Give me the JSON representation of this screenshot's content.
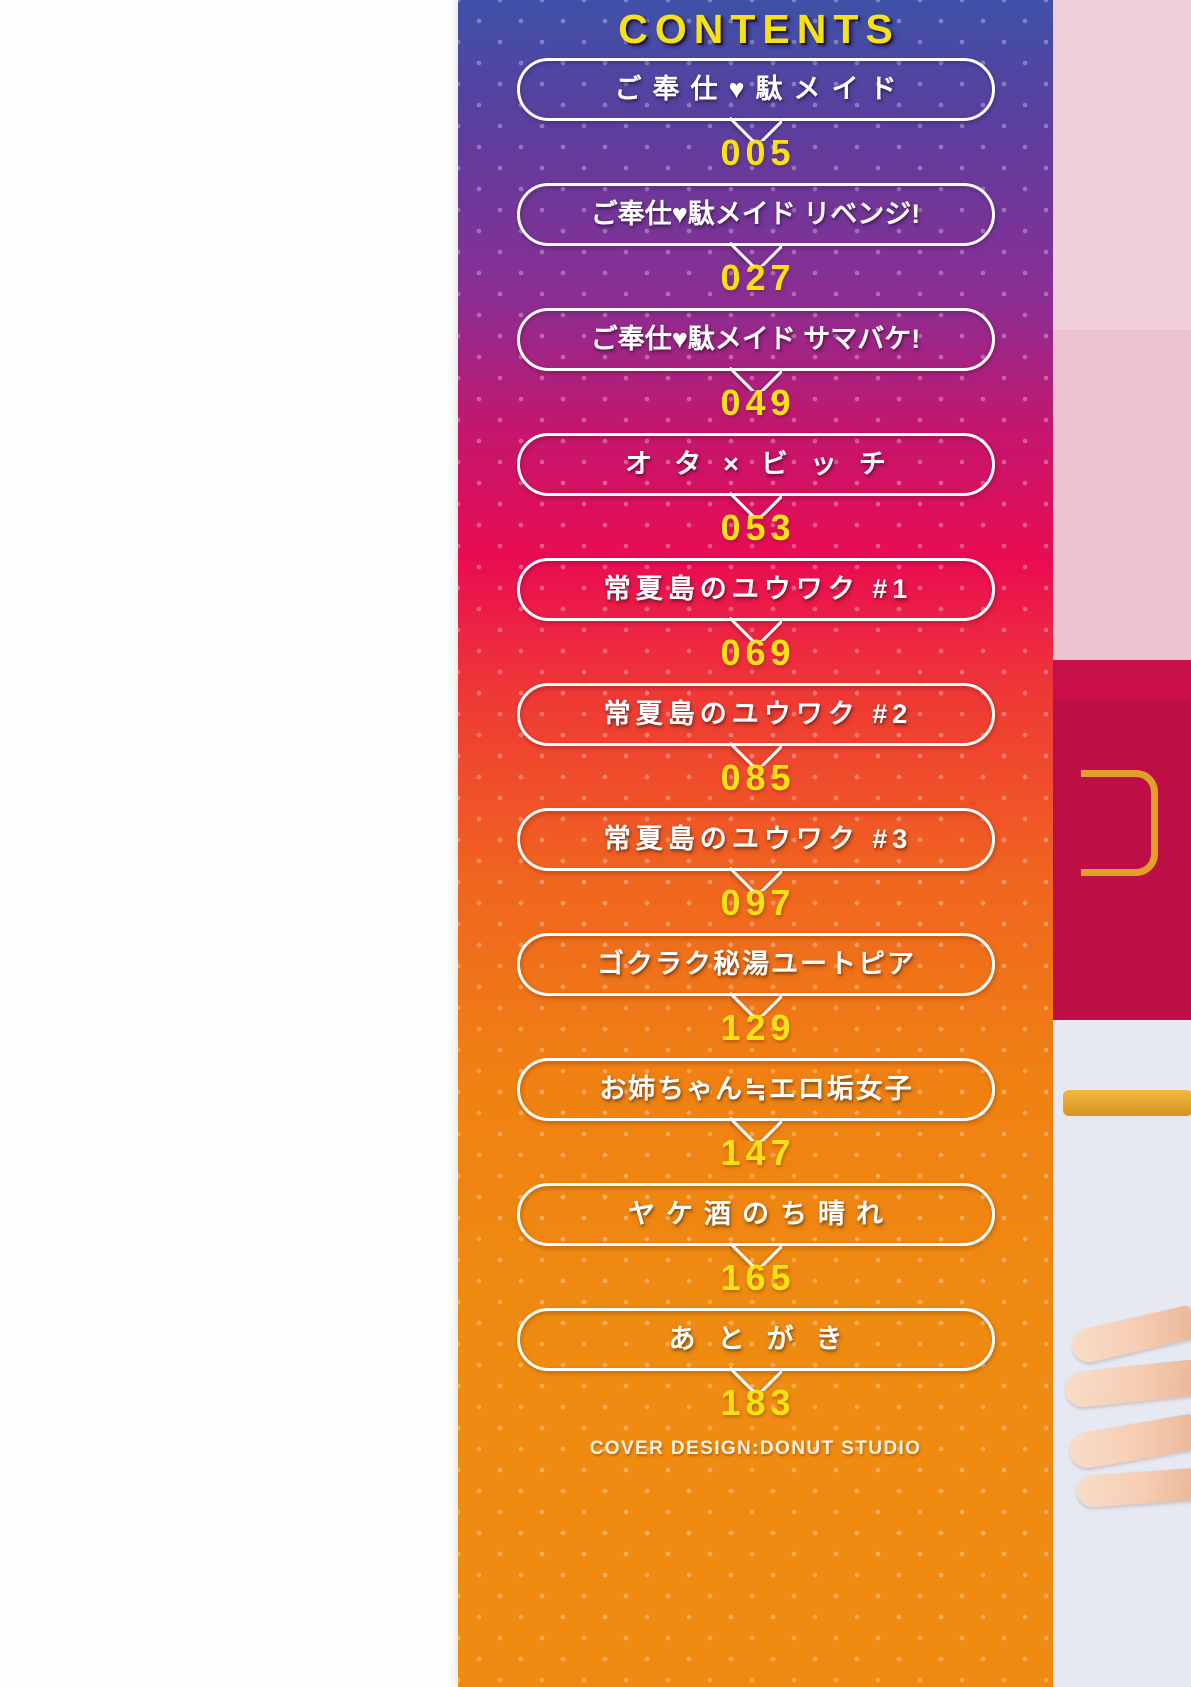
{
  "panel": {
    "title": "CONTENTS",
    "credit": "COVER DESIGN:DONUT STUDIO",
    "colors": {
      "accent_yellow": "#f5e215",
      "outline_white": "#ffffff",
      "gradient_top": "#3f51a8",
      "gradient_mid": "#ea0c52",
      "gradient_bottom": "#ef8b11"
    }
  },
  "entries": [
    {
      "title": "ご奉仕♥駄メイド",
      "page": "005",
      "style": "tracked"
    },
    {
      "title": "ご奉仕♥駄メイド リベンジ!",
      "page": "027",
      "style": "compact"
    },
    {
      "title": "ご奉仕♥駄メイド サマバケ!",
      "page": "049",
      "style": "compact"
    },
    {
      "title": "オタ×ビッチ",
      "page": "053",
      "style": "tracked-xl"
    },
    {
      "title": "常夏島のユウワク #1",
      "page": "069",
      "style": "tracked-s"
    },
    {
      "title": "常夏島のユウワク #2",
      "page": "085",
      "style": "tracked-s"
    },
    {
      "title": "常夏島のユウワク #3",
      "page": "097",
      "style": "tracked-s"
    },
    {
      "title": "ゴクラク秘湯ユートピア",
      "page": "129",
      "style": "tracked-xs"
    },
    {
      "title": "お姉ちゃん≒エロ垢女子",
      "page": "147",
      "style": "tracked-xs"
    },
    {
      "title": "ヤケ酒のち晴れ",
      "page": "165",
      "style": "tracked"
    },
    {
      "title": "あとがき",
      "page": "183",
      "style": "tracked-xl"
    }
  ]
}
